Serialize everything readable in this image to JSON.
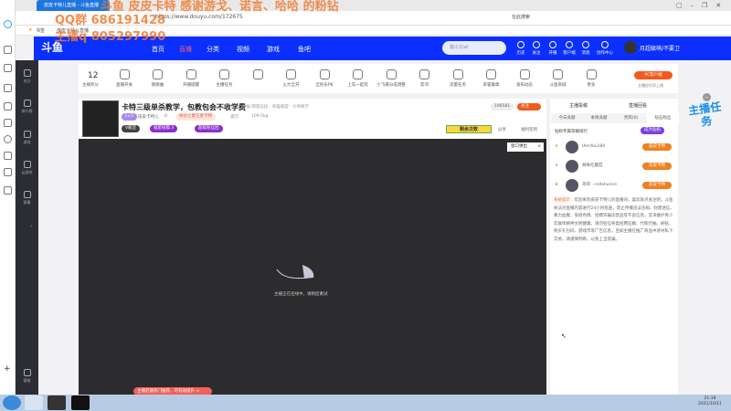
{
  "browser": {
    "tab_title": "皮皮卡特儿直播 - 斗鱼直播",
    "url": "https://www.douyu.com/172675",
    "bookmark_label": "书签",
    "bookmark_item": "皮皮卡特儿直播",
    "search_box": "在此搜索"
  },
  "watermark": [
    "斗鱼 皮皮卡特 感谢游戈、诺言、哈哈 的粉钻",
    "QQ群 686191428",
    "主播q 805297990"
  ],
  "nav": {
    "items": [
      "首页",
      "直播",
      "分类",
      "视频",
      "游戏",
      "鱼吧"
    ],
    "search_placeholder": "迦小又wl",
    "icons": [
      "历史",
      "关注",
      "开播",
      "客户端",
      "消息",
      "创作中心"
    ],
    "user_name": "月超級萌/不要卫"
  },
  "left_sidebar": [
    "关注",
    "排行榜",
    "游戏",
    "云游戏",
    "赛事",
    "客服"
  ],
  "toolbar": {
    "score": "12",
    "score_label": "主播积分",
    "items": [
      "直播开关",
      "猜歌曲",
      "开播提醒",
      "主播任务",
      "",
      "火力全开",
      "全民乐PK",
      "上车一起玩",
      "小飞碟分成调整",
      "友邻",
      "流量任务",
      "荣誉徽章",
      "发布动态",
      "斗鱼商城",
      "更多"
    ],
    "pc_client": "PC客户端",
    "pc_note": "主播应尽早上线"
  },
  "room": {
    "title": "卡特三级单杀教学，包教包会不收学费",
    "tags": "举报  网游竞技 · 英雄联盟 · 大神教学",
    "level": "Lv.5",
    "host": "皮皮卡特儿",
    "hot": "0",
    "rank": "峡谷之巅王者卡特",
    "viewers": "道万",
    "weight": "109.5kg",
    "badges": [
      "V殿堂",
      "福星班稿 3",
      "超级粉丝团"
    ],
    "follow_count": "196581",
    "follow": "关注",
    "remaining": "剩余次数",
    "share": "分享",
    "clip": "福利签到"
  },
  "video": {
    "popout": "窗口弹出",
    "status": "主播正在连线中，请稍后重试"
  },
  "right": {
    "top_links": [
      "主播投稿",
      "直播回看"
    ],
    "tabs": [
      "今日贡献",
      "本周贡献",
      "贵宾(0)",
      "钻石粉丝"
    ],
    "fans_header": "钻粉专属荣耀排行",
    "become": "成为钻粉",
    "ranks": [
      {
        "name": "IAmYou184"
      },
      {
        "name": "咻咻吃蘑菇"
      },
      {
        "name": "哥哥 · cellahunne"
      }
    ],
    "badge": "皮皮卡特",
    "notice_label": "系统提示：",
    "notice": "欢迎来到皮皮卡特儿的直播间，喜欢就点关注吧。斗鱼依法对直播内容进行24小时巡查，禁止传播违法违规、封建迷信、暴力血腥、低俗色情、招嫖诈骗违禁品等不良信息，坚决维护青少年群体精神文明健康。请勿轻信各类招聘征婚、代练代抽、刷钻、购买礼包码、游戏币等广告信息，且如主播在推广商品中诱导私下交易，请谨慎判断，以免上当受骗。"
  },
  "floating": "主播任务",
  "toast": "主播近期热门推荐，可有效提升",
  "taskbar": {
    "time": "21:18",
    "date": "2021/10/11"
  }
}
